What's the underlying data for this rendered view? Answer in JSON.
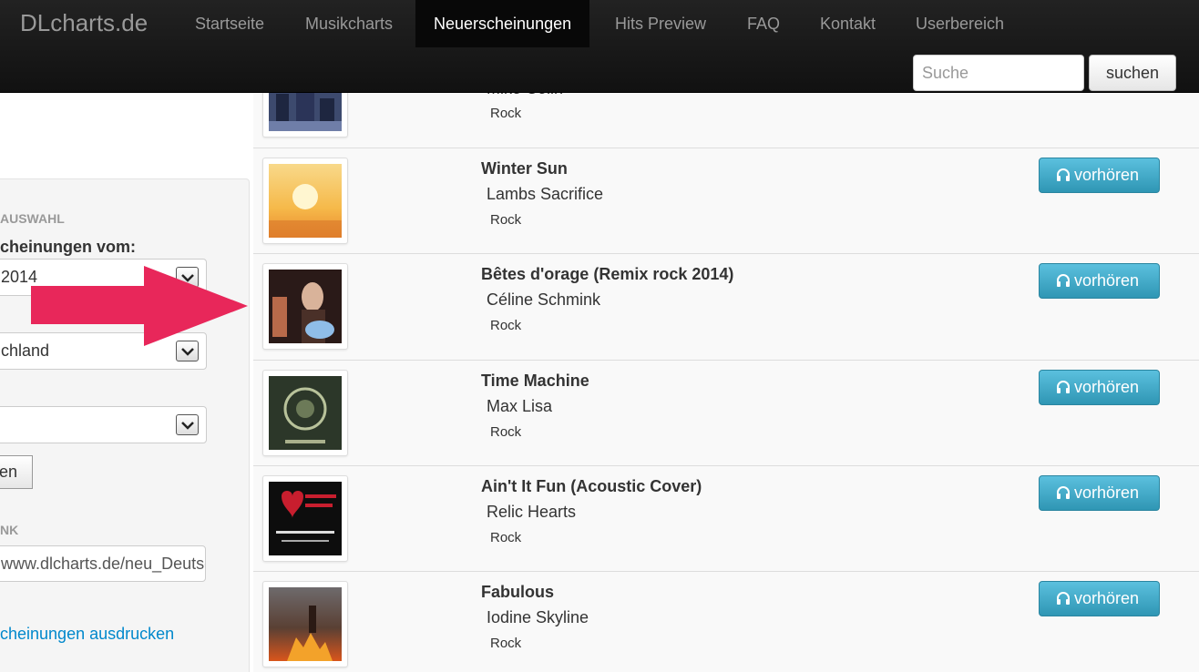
{
  "nav": {
    "brand": "DLcharts.de",
    "items": [
      {
        "label": "Startseite"
      },
      {
        "label": "Musikcharts"
      },
      {
        "label": "Neuerscheinungen"
      },
      {
        "label": "Hits Preview"
      },
      {
        "label": "FAQ"
      },
      {
        "label": "Kontakt"
      },
      {
        "label": "Userbereich"
      }
    ],
    "search_placeholder": "Suche",
    "search_button": "suchen"
  },
  "sidebar": {
    "section_heading": "AUSWAHL",
    "date_label": "cheinungen vom:",
    "date_value": "2014",
    "country_value": "chland",
    "genre_value": "",
    "submit_label": "en",
    "link_heading": "NK",
    "link_value": "www.dlcharts.de/neu_Deutschland",
    "print_link": "cheinungen ausdrucken"
  },
  "releases": [
    {
      "title": "",
      "artist": "Mike Colin",
      "genre": "Rock",
      "button": "",
      "art_color": "#6f7ea8"
    },
    {
      "title": "Winter Sun",
      "artist": "Lambs Sacrifice",
      "genre": "Rock",
      "button": "vorhören",
      "art_color": "#f6b94a"
    },
    {
      "title": "Bêtes d'orage (Remix rock 2014)",
      "artist": "Céline Schmink",
      "genre": "Rock",
      "button": "vorhören",
      "art_color": "#2a1a18"
    },
    {
      "title": "Time Machine",
      "artist": "Max Lisa",
      "genre": "Rock",
      "button": "vorhören",
      "art_color": "#3b4a37"
    },
    {
      "title": "Ain't It Fun (Acoustic Cover)",
      "artist": "Relic Hearts",
      "genre": "Rock",
      "button": "vorhören",
      "art_color": "#111111"
    },
    {
      "title": "Fabulous",
      "artist": "Iodine Skyline",
      "genre": "Rock",
      "button": "vorhören",
      "art_color": "#5a4034"
    }
  ],
  "colors": {
    "accent_arrow": "#e8275a",
    "listen_button": "#3aa7cc",
    "link": "#0088cc"
  }
}
